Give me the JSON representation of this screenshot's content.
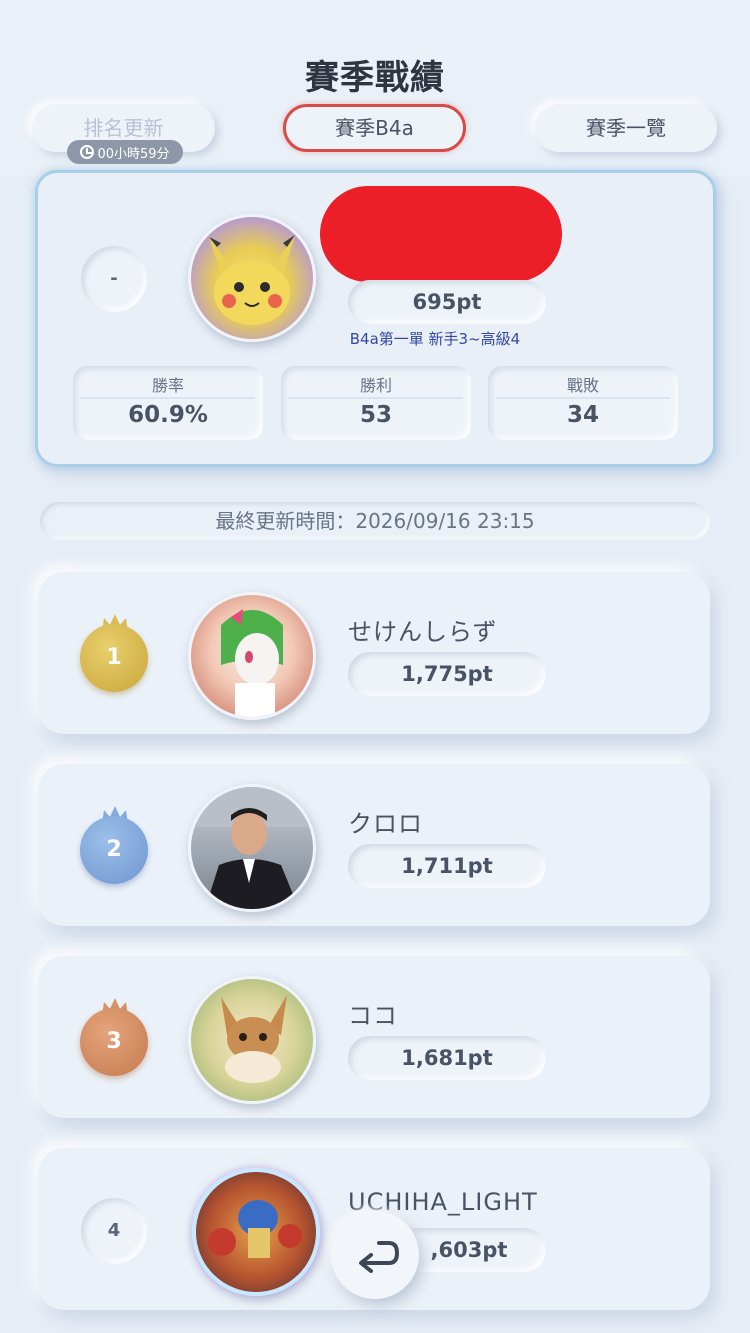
{
  "header": {
    "title": "賽季戰績",
    "rank_update_label": "排名更新",
    "timer": "00小時59分",
    "season_label": "賽季B4a",
    "season_list_label": "賽季一覽"
  },
  "me": {
    "rank": "-",
    "points": "695pt",
    "note": "B4a第一單 新手3~高級4",
    "stats": [
      {
        "label": "勝率",
        "value": "60.9%"
      },
      {
        "label": "勝利",
        "value": "53"
      },
      {
        "label": "戰敗",
        "value": "34"
      }
    ]
  },
  "last_update": "最終更新時間：2026/09/16 23:15",
  "leaderboard": [
    {
      "rank": "1",
      "name": "せけんしらず",
      "points": "1,775pt",
      "medal": "gold"
    },
    {
      "rank": "2",
      "name": "クロロ",
      "points": "1,711pt",
      "medal": "silver"
    },
    {
      "rank": "3",
      "name": "ココ",
      "points": "1,681pt",
      "medal": "bronze"
    },
    {
      "rank": "4",
      "name": "UCHIHA_LIGHT",
      "points": ",603pt",
      "medal": "none"
    }
  ],
  "icons": {
    "back": "back-arrow-icon",
    "clock": "clock-icon",
    "crown": "crown-icon"
  },
  "colors": {
    "accent": "#d94a4a",
    "line": "#5fc6dc",
    "redaction": "#ec1e27"
  }
}
